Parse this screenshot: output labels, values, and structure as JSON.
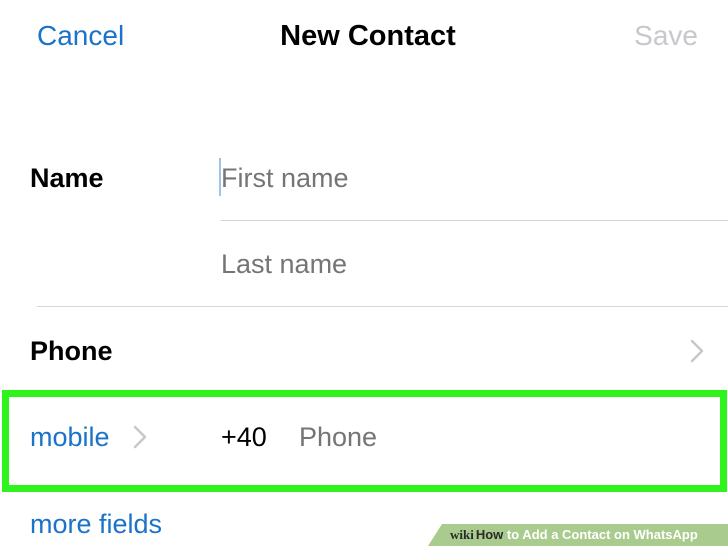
{
  "navbar": {
    "cancel_label": "Cancel",
    "title": "New Contact",
    "save_label": "Save"
  },
  "name_section": {
    "label": "Name",
    "first_name_placeholder": "First name",
    "last_name_placeholder": "Last name"
  },
  "phone_section": {
    "label": "Phone",
    "chevron_icon": "chevron-right-icon"
  },
  "mobile_row": {
    "type_label": "mobile",
    "type_chevron_icon": "chevron-right-icon",
    "country_code": "+40",
    "phone_placeholder": "Phone",
    "highlight_color": "#2ef41b"
  },
  "more_fields_label": "more fields",
  "watermark": {
    "brand": "wiki",
    "how_label": "How",
    "rest_label": " to Add a Contact on WhatsApp"
  },
  "colors": {
    "accent": "#1a73c9",
    "disabled": "#c7c7cc",
    "placeholder": "#c3c3c8",
    "divider": "#d6d6d9"
  }
}
